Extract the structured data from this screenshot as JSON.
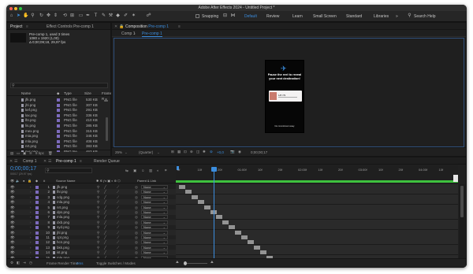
{
  "window": {
    "title": "Adobe After Effects 2024 - Untitled Project *"
  },
  "toolbar": {
    "snapping_label": "Snapping",
    "workspaces": [
      "Default",
      "Review",
      "Learn",
      "Small Screen",
      "Standard",
      "Libraries"
    ],
    "active_workspace": "Default",
    "more_label": "»",
    "search_placeholder": "Search Help"
  },
  "project_panel": {
    "tab_project": "Project",
    "tab_effects": "Effect Controls Pre-comp 1",
    "item_name": "Pre-comp 1",
    "item_usage": ", used 3 times",
    "item_dims": "1080 x 1920 (1,00)",
    "item_duration": "Δ 0;00;09;18, 29,97 fps",
    "search_placeholder": "",
    "columns": {
      "name": "Name",
      "type": "Type",
      "size": "Size",
      "frame": "Frame R"
    },
    "files": [
      {
        "name": "jfk.png",
        "type": "PNG file",
        "size": "530 KB"
      },
      {
        "name": "jhl.png",
        "type": "PNG file",
        "size": "307 KB"
      },
      {
        "name": "kef.png",
        "type": "PNG file",
        "size": "291 KB"
      },
      {
        "name": "lax.png",
        "type": "PNG file",
        "size": "336 KB"
      },
      {
        "name": "lhr.png",
        "type": "PNG file",
        "size": "410 KB"
      },
      {
        "name": "lis.png",
        "type": "PNG file",
        "size": "385 KB"
      },
      {
        "name": "mex.png",
        "type": "PNG file",
        "size": "315 KB"
      },
      {
        "name": "mia.png",
        "type": "PNG file",
        "size": "346 KB"
      },
      {
        "name": "mla.png",
        "type": "PNG file",
        "size": "408 KB"
      },
      {
        "name": "nrt.png",
        "type": "PNG file",
        "size": "383 KB"
      },
      {
        "name": "nyc.png",
        "type": "PNG file",
        "size": "463 KB"
      },
      {
        "name": "opo.png",
        "type": "PNG file",
        "size": "344 KB"
      },
      {
        "name": "osl.png",
        "type": "PNG file",
        "size": "349 KB"
      },
      {
        "name": "pek.png",
        "type": "PNG file",
        "size": "421 KB"
      }
    ],
    "bpc": "8 bpc"
  },
  "comp_panel": {
    "tab_label": "Composition",
    "tab_comp": "Pre-comp 1",
    "menu_icon": "≡",
    "breadcrumb_1": "Comp 1",
    "breadcrumb_2": "Pre-comp 1",
    "phone": {
      "title": "Pause the reel to reveal your next destination!",
      "caption": "No commitment away",
      "price": "1/8 7/9"
    },
    "zoom": "25%",
    "resolution": "(Quarter)",
    "exposure": "+0,0",
    "timecode": "0;00;00;17"
  },
  "timeline": {
    "tab_comp1": "Comp 1",
    "tab_precomp": "Pre-comp 1",
    "tab_render": "Render Queue",
    "current_time": "0;00;00;17",
    "fps_label": "00017 (29.97 fps)",
    "col_source": "Source Name",
    "col_parent": "Parent & Link",
    "ruler": [
      "0f",
      "10f",
      "20f",
      "01:00f",
      "10f",
      "20f",
      "02:00f",
      "10f",
      "20f",
      "03:00f",
      "10f",
      "20f",
      "04:00f",
      "10f"
    ],
    "layers": [
      {
        "num": "1",
        "name": "jfk.png",
        "parent": "None"
      },
      {
        "num": "2",
        "name": "lhr.png",
        "parent": "None"
      },
      {
        "num": "3",
        "name": "cdg.png",
        "parent": "None"
      },
      {
        "num": "4",
        "name": "mla.png",
        "parent": "None"
      },
      {
        "num": "5",
        "name": "nrt.png",
        "parent": "None"
      },
      {
        "num": "6",
        "name": "dps.png",
        "parent": "None"
      },
      {
        "num": "7",
        "name": "mla.png",
        "parent": "None"
      },
      {
        "num": "8",
        "name": "dxb.png",
        "parent": "None"
      },
      {
        "num": "9",
        "name": "syd.png",
        "parent": "None"
      },
      {
        "num": "10",
        "name": "jhl.png",
        "parent": "None"
      },
      {
        "num": "11",
        "name": "cpt.png",
        "parent": "None"
      },
      {
        "num": "12",
        "name": "hcn.png",
        "parent": "None"
      },
      {
        "num": "13",
        "name": "bkk.png",
        "parent": "None"
      },
      {
        "num": "14",
        "name": "ist.png",
        "parent": "None"
      },
      {
        "num": "15",
        "name": "mle.png",
        "parent": "None"
      }
    ],
    "frame_render_label": "Frame Render Time",
    "frame_render_value": "0ms",
    "toggle_label": "Toggle Switches / Modes"
  },
  "colors": {
    "accent": "#3b8dde",
    "playhead": "#3b8dde",
    "work_area": "#3ec23e",
    "label_swatch": "#7d6bbd"
  }
}
